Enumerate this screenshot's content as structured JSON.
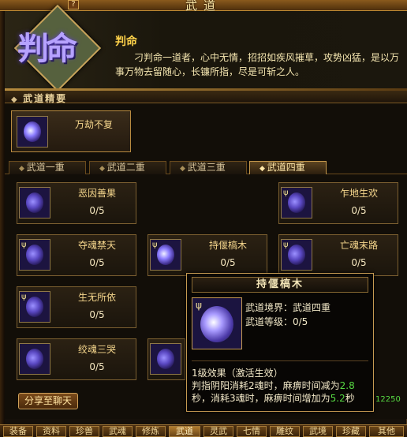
{
  "window": {
    "title": "武道",
    "help_label": "?"
  },
  "book": {
    "emblem_text": "判命",
    "name": "判命",
    "description": "刁判命一道者，心中无情，招招如疾风摧草，攻势凶猛，是以万事万物去留随心，长镰所指，尽是可斩之人。"
  },
  "section": {
    "title": "武道精要"
  },
  "main_skill": {
    "name": "万劫不复"
  },
  "tabs": [
    {
      "label": "武道一重"
    },
    {
      "label": "武道二重"
    },
    {
      "label": "武道三重"
    },
    {
      "label": "武道四重"
    }
  ],
  "skills": [
    {
      "name": "恶因善果",
      "level": "0/5"
    },
    {
      "name": "乍地生欢",
      "level": "0/5"
    },
    {
      "name": "夺魂禁天",
      "level": "0/5"
    },
    {
      "name": "持偃槁木",
      "level": "0/5"
    },
    {
      "name": "亡魂末路",
      "level": "0/5"
    },
    {
      "name": "生无所依",
      "level": "0/5"
    },
    {
      "name": "绞魂三哭",
      "level": "0/5"
    }
  ],
  "tooltip": {
    "title": "持偃槁木",
    "realm": "武道境界：武道四重",
    "level": "武道等级：0/5",
    "effect_head": "1级效果（激活生效）",
    "effect_part1": "判指阴阳消耗2魂时，麻痹时间减为",
    "effect_num1": "2.8",
    "effect_part2": "秒，消耗3魂时，麻痹时间增加为",
    "effect_num2": "5.2",
    "effect_part3": "秒"
  },
  "share_button": "分享至聊天",
  "side_number": "12250",
  "bottom_tabs": [
    {
      "label": "装备"
    },
    {
      "label": "资料"
    },
    {
      "label": "珍兽"
    },
    {
      "label": "武魂"
    },
    {
      "label": "修炼"
    },
    {
      "label": "武道"
    },
    {
      "label": "灵武"
    },
    {
      "label": "七情"
    },
    {
      "label": "雕纹"
    },
    {
      "label": "武境"
    },
    {
      "label": "珍藏"
    },
    {
      "label": "其他"
    }
  ],
  "colors": {
    "gold_text": "#f6d78d",
    "green_number": "#57d943",
    "frame_border": "#c59a52"
  }
}
